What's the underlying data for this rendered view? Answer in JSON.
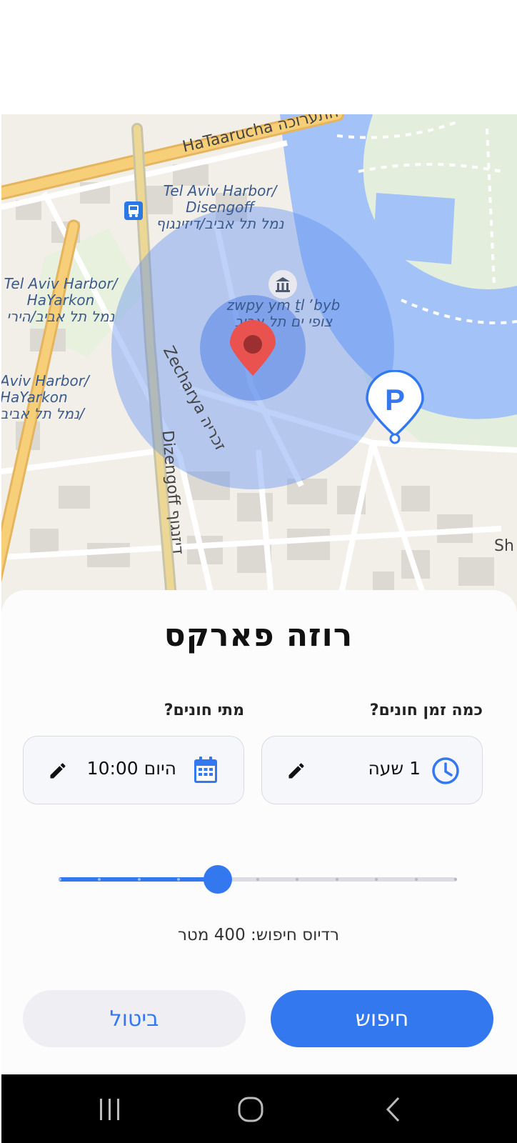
{
  "map": {
    "streets": {
      "hataarucha": "HaTaarucha",
      "hataarucha_heb": "התערוכה",
      "zecharya": "Zecharya",
      "zecharya_heb": "זכריה",
      "dizengoff": "Dizengoff",
      "dizengoff_heb": "דיזנגוף",
      "sh": "Sh"
    },
    "stops": {
      "tel_aviv_harbor_disengoff": [
        "Tel Aviv Harbor/",
        "Disengoff",
        "נמל תל אביב/דיזינגוף"
      ],
      "tel_aviv_harbor_hayarkon": [
        "Tel Aviv Harbor/",
        "HaYarkon",
        "נמל תל אביב/הירי"
      ],
      "aviv_harbor_hayarkon": [
        "Aviv Harbor/",
        "HaYarkon",
        "נמל תל אביב/"
      ],
      "zwpy": [
        "zwpy ym ṯl ʼbyb",
        "צופי ים תל אביב"
      ]
    },
    "search_radius_m": 400,
    "icons": {
      "location": "map-pin-icon",
      "parking": "parking-pin-icon",
      "bus": "bus-stop-icon",
      "museum": "museum-icon"
    }
  },
  "sheet": {
    "title": "רוזה פארקס",
    "duration": {
      "label": "כמה זמן חונים?",
      "value": "1 שעה",
      "icon": "clock-icon",
      "edit_icon": "pencil-icon"
    },
    "when": {
      "label": "מתי חונים?",
      "value": "היום 10:00",
      "icon": "calendar-icon",
      "edit_icon": "pencil-icon"
    },
    "slider": {
      "steps": 11,
      "selected_step": 4,
      "position": 0.4
    },
    "radius_text": "רדיוס חיפוש: 400 מטר",
    "buttons": {
      "search": "חיפוש",
      "cancel": "ביטול"
    }
  },
  "colors": {
    "accent": "#3478f0",
    "cancel_bg": "#eeeef3",
    "map_pin": "#e9524f",
    "radius_circle": "#5b8def",
    "water": "#a3c2f7",
    "park": "#e3eedc",
    "road_major": "#f6cf78"
  },
  "navbar": {
    "icons": [
      "recents-icon",
      "home-icon",
      "back-icon"
    ]
  }
}
